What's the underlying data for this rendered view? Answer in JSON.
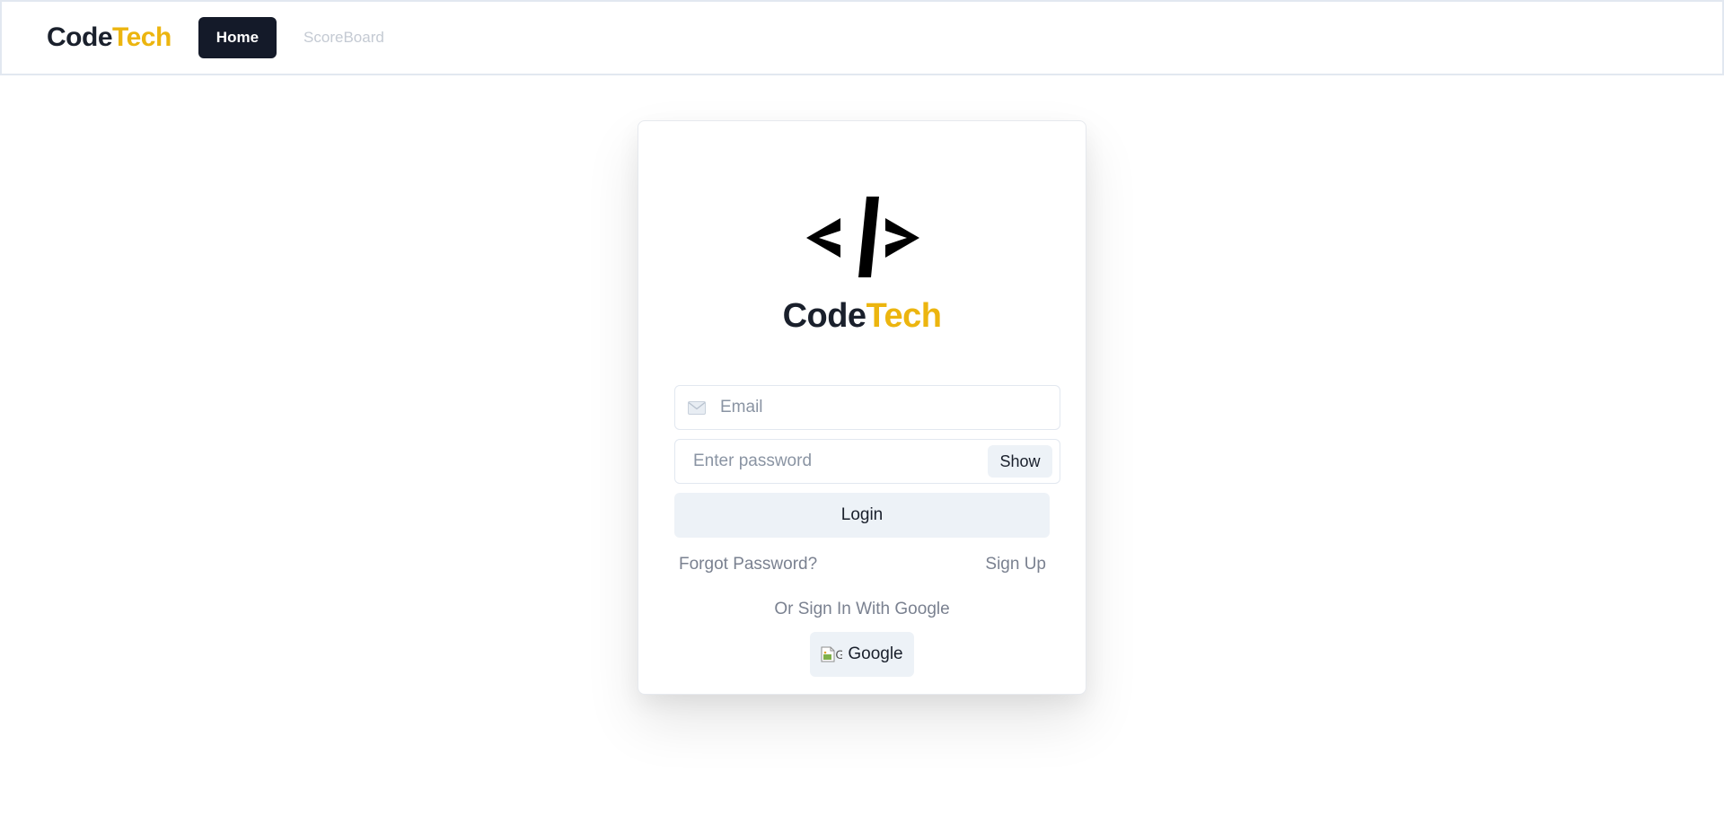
{
  "navbar": {
    "brand_code": "Code",
    "brand_tech": "Tech",
    "home_label": "Home",
    "scoreboard_label": "ScoreBoard"
  },
  "login": {
    "logo_icon": "code-brackets-icon",
    "brand_code": "Code",
    "brand_tech": "Tech",
    "email_placeholder": "Email",
    "email_icon": "mail-icon",
    "password_placeholder": "Enter password",
    "show_label": "Show",
    "login_label": "Login",
    "forgot_label": "Forgot Password?",
    "signup_label": "Sign Up",
    "or_label": "Or Sign In With Google",
    "google_label": "Google",
    "google_img_alt": "G"
  },
  "colors": {
    "brand_dark": "#1a202c",
    "brand_accent": "#ecb50f",
    "home_button_bg": "#141a29",
    "soft_button_bg": "#edf2f7"
  }
}
